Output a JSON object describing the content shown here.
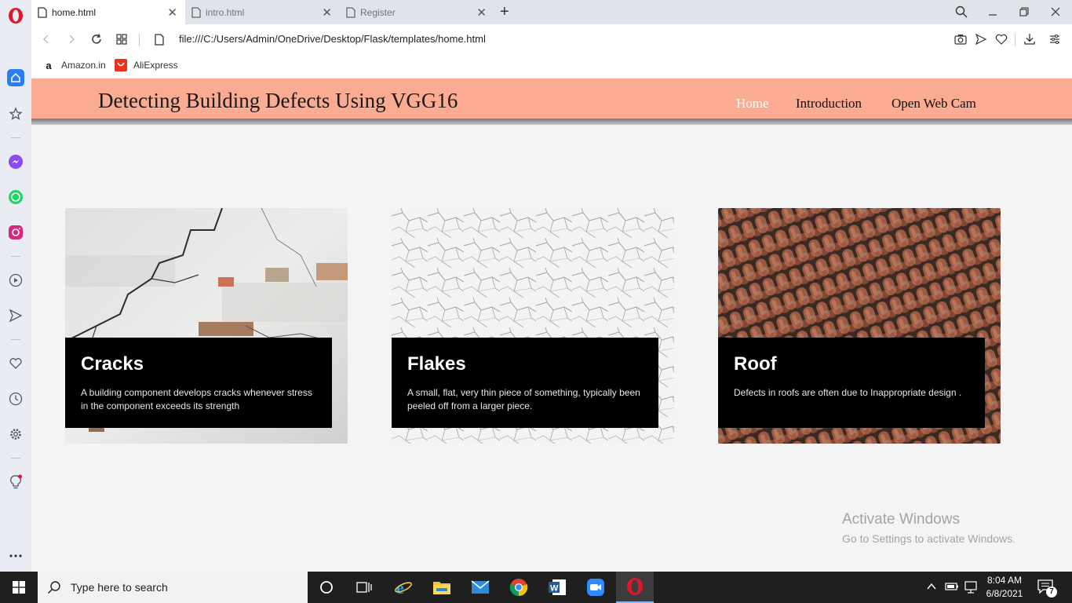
{
  "browser": {
    "tabs": [
      {
        "title": "home.html",
        "active": true
      },
      {
        "title": "intro.html",
        "active": false
      },
      {
        "title": "Register",
        "active": false
      }
    ],
    "new_tab_symbol": "+",
    "url": "file:///C:/Users/Admin/OneDrive/Desktop/Flask/templates/home.html",
    "bookmarks": [
      {
        "label": "Amazon.in",
        "icon": "amazon-icon"
      },
      {
        "label": "AliExpress",
        "icon": "aliexpress-icon"
      }
    ]
  },
  "site": {
    "title": "Detecting Building Defects Using VGG16",
    "header_color": "#fbab92",
    "nav": [
      {
        "label": "Home",
        "active": true
      },
      {
        "label": "Introduction",
        "active": false
      },
      {
        "label": "Open Web Cam",
        "active": false
      }
    ],
    "cards": [
      {
        "title": "Cracks",
        "text": "A building component develops cracks whenever stress in the component exceeds its strength",
        "image": "cracked-wall"
      },
      {
        "title": "Flakes",
        "text": "A small, flat, very thin piece of something, typically been peeled off from a larger piece.",
        "image": "flaking-paint"
      },
      {
        "title": "Roof",
        "text": "Defects in roofs are often due to Inappropriate design .",
        "image": "roof-tiles"
      }
    ]
  },
  "watermark": {
    "line1": "Activate Windows",
    "line2": "Go to Settings to activate Windows."
  },
  "taskbar": {
    "search_placeholder": "Type here to search",
    "time": "8:04 AM",
    "date": "6/8/2021",
    "notification_count": "7"
  }
}
